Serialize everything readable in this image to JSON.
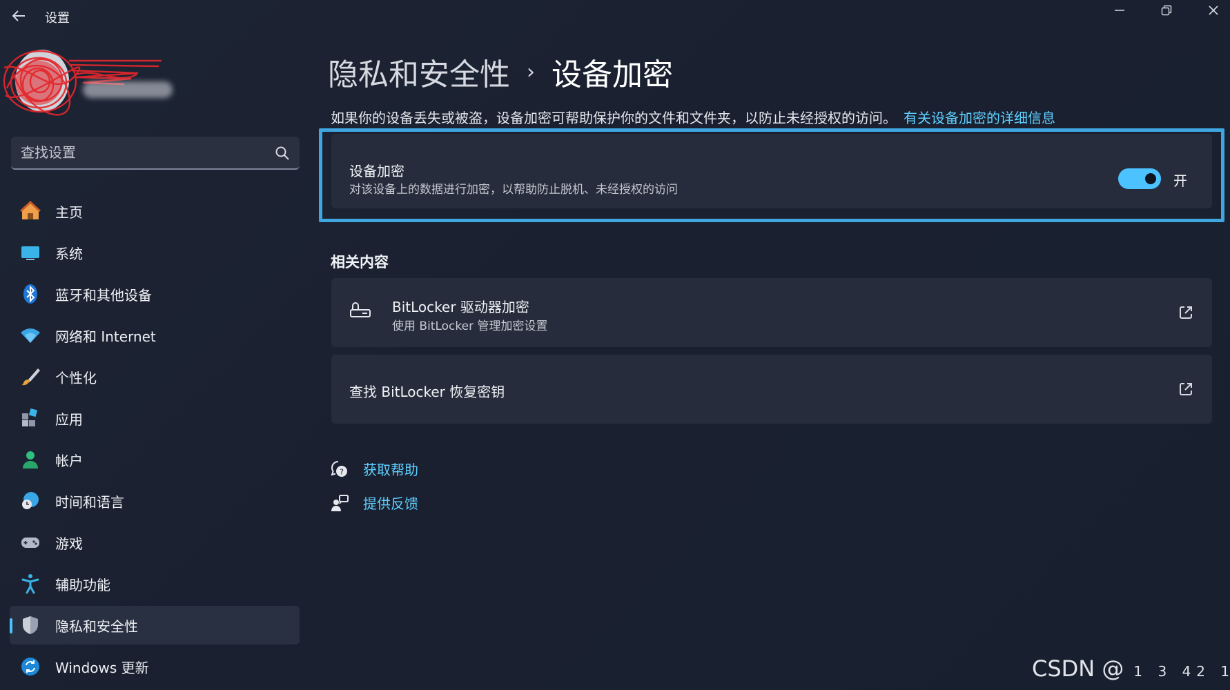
{
  "app": {
    "title": "设置"
  },
  "search": {
    "placeholder": "查找设置"
  },
  "nav": {
    "items": [
      {
        "label": "主页",
        "icon": "home-icon"
      },
      {
        "label": "系统",
        "icon": "monitor-icon"
      },
      {
        "label": "蓝牙和其他设备",
        "icon": "bluetooth-icon"
      },
      {
        "label": "网络和 Internet",
        "icon": "wifi-icon"
      },
      {
        "label": "个性化",
        "icon": "brush-icon"
      },
      {
        "label": "应用",
        "icon": "apps-icon"
      },
      {
        "label": "帐户",
        "icon": "person-icon"
      },
      {
        "label": "时间和语言",
        "icon": "globe-clock-icon"
      },
      {
        "label": "游戏",
        "icon": "gamepad-icon"
      },
      {
        "label": "辅助功能",
        "icon": "accessibility-icon"
      },
      {
        "label": "隐私和安全性",
        "icon": "shield-icon",
        "active": true
      },
      {
        "label": "Windows 更新",
        "icon": "update-icon"
      }
    ]
  },
  "breadcrumb": {
    "parent": "隐私和安全性",
    "separator": "›",
    "current": "设备加密"
  },
  "description": {
    "text": "如果你的设备丢失或被盗，设备加密可帮助保护你的文件和文件夹，以防止未经授权的访问。",
    "link": "有关设备加密的详细信息"
  },
  "encryption_card": {
    "title": "设备加密",
    "subtitle": "对该设备上的数据进行加密，以帮助防止脱机、未经授权的访问",
    "toggle_on": true,
    "toggle_label": "开"
  },
  "related": {
    "heading": "相关内容",
    "bitlocker": {
      "title": "BitLocker 驱动器加密",
      "subtitle": "使用 BitLocker 管理加密设置"
    },
    "recovery": {
      "title": "查找 BitLocker 恢复密钥"
    }
  },
  "help": {
    "get_help": "获取帮助",
    "feedback": "提供反馈"
  },
  "watermark": {
    "text": "CSDN @",
    "suffix": "1 3  42 1"
  },
  "colors": {
    "accent": "#4cc2ff",
    "link": "#5fd0ff",
    "highlight_border": "#3fa6e0"
  }
}
